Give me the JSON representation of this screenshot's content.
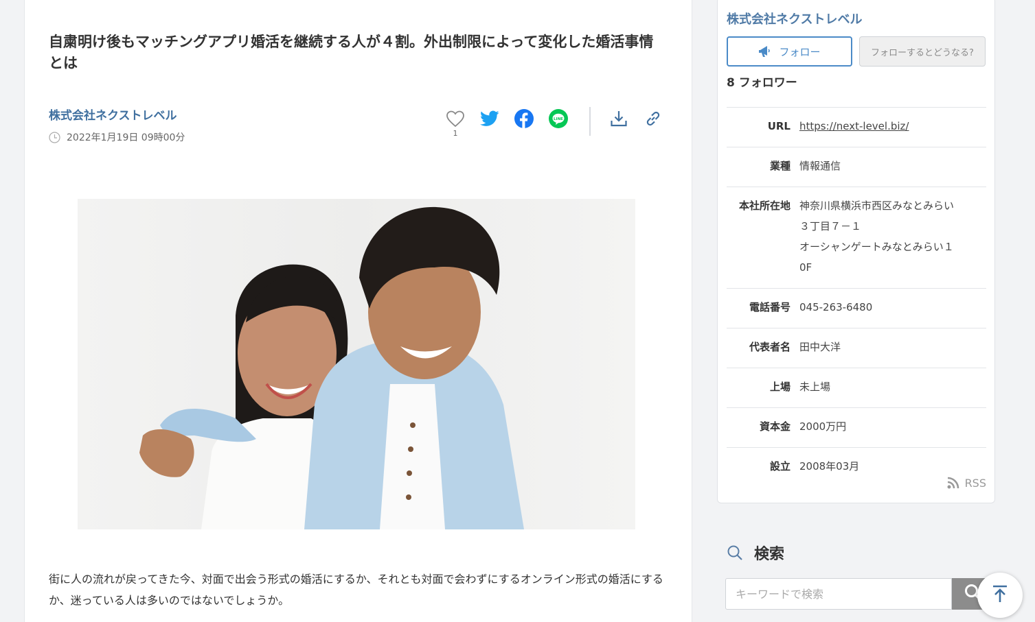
{
  "article": {
    "title": "自粛明け後もマッチングアプリ婚活を継続する人が４割。外出制限によって変化した婚活事情とは",
    "company": "株式会社ネクストレベル",
    "date": "2022年1月19日 09時00分",
    "like_count": "1",
    "body": "街に人の流れが戻ってきた今、対面で出会う形式の婚活にするか、それとも対面で会わずにするオンライン形式の婚活にするか、迷っている人は多いのではないでしょうか。",
    "icons": {
      "like": "heart-icon",
      "twitter": "twitter-icon",
      "facebook": "facebook-icon",
      "line": "line-icon",
      "download": "download-icon",
      "link": "link-icon"
    }
  },
  "sidebar": {
    "company": "株式会社ネクストレベル",
    "follow_label": "フォロー",
    "follow_help_label": "フォローするとどうなる?",
    "followers": "8 フォロワー",
    "info": [
      {
        "label": "URL",
        "value": "https://next-level.biz/"
      },
      {
        "label": "業種",
        "value": "情報通信"
      },
      {
        "label": "本社所在地",
        "value": "神奈川県横浜市西区みなとみらい３丁目７－１"
      },
      {
        "label": "本社所在地_line2",
        "value": "オーシャンゲートみなとみらい１0F"
      },
      {
        "label": "電話番号",
        "value": "045-263-6480"
      },
      {
        "label": "代表者名",
        "value": "田中大洋"
      },
      {
        "label": "上場",
        "value": "未上場"
      },
      {
        "label": "資本金",
        "value": "2000万円"
      },
      {
        "label": "設立",
        "value": "2008年03月"
      }
    ],
    "address_lines": [
      "神奈川県横浜市西区みなとみらい",
      "３丁目７－１",
      "オーシャンゲートみなとみらい１",
      "0F"
    ],
    "rss": "RSS"
  },
  "search": {
    "heading": "検索",
    "placeholder": "キーワードで検索"
  },
  "colors": {
    "brand_blue": "#4f7aa6",
    "twitter": "#1da1f2",
    "facebook": "#1877f2",
    "line": "#06c755",
    "search_button": "#8c8c8c"
  }
}
